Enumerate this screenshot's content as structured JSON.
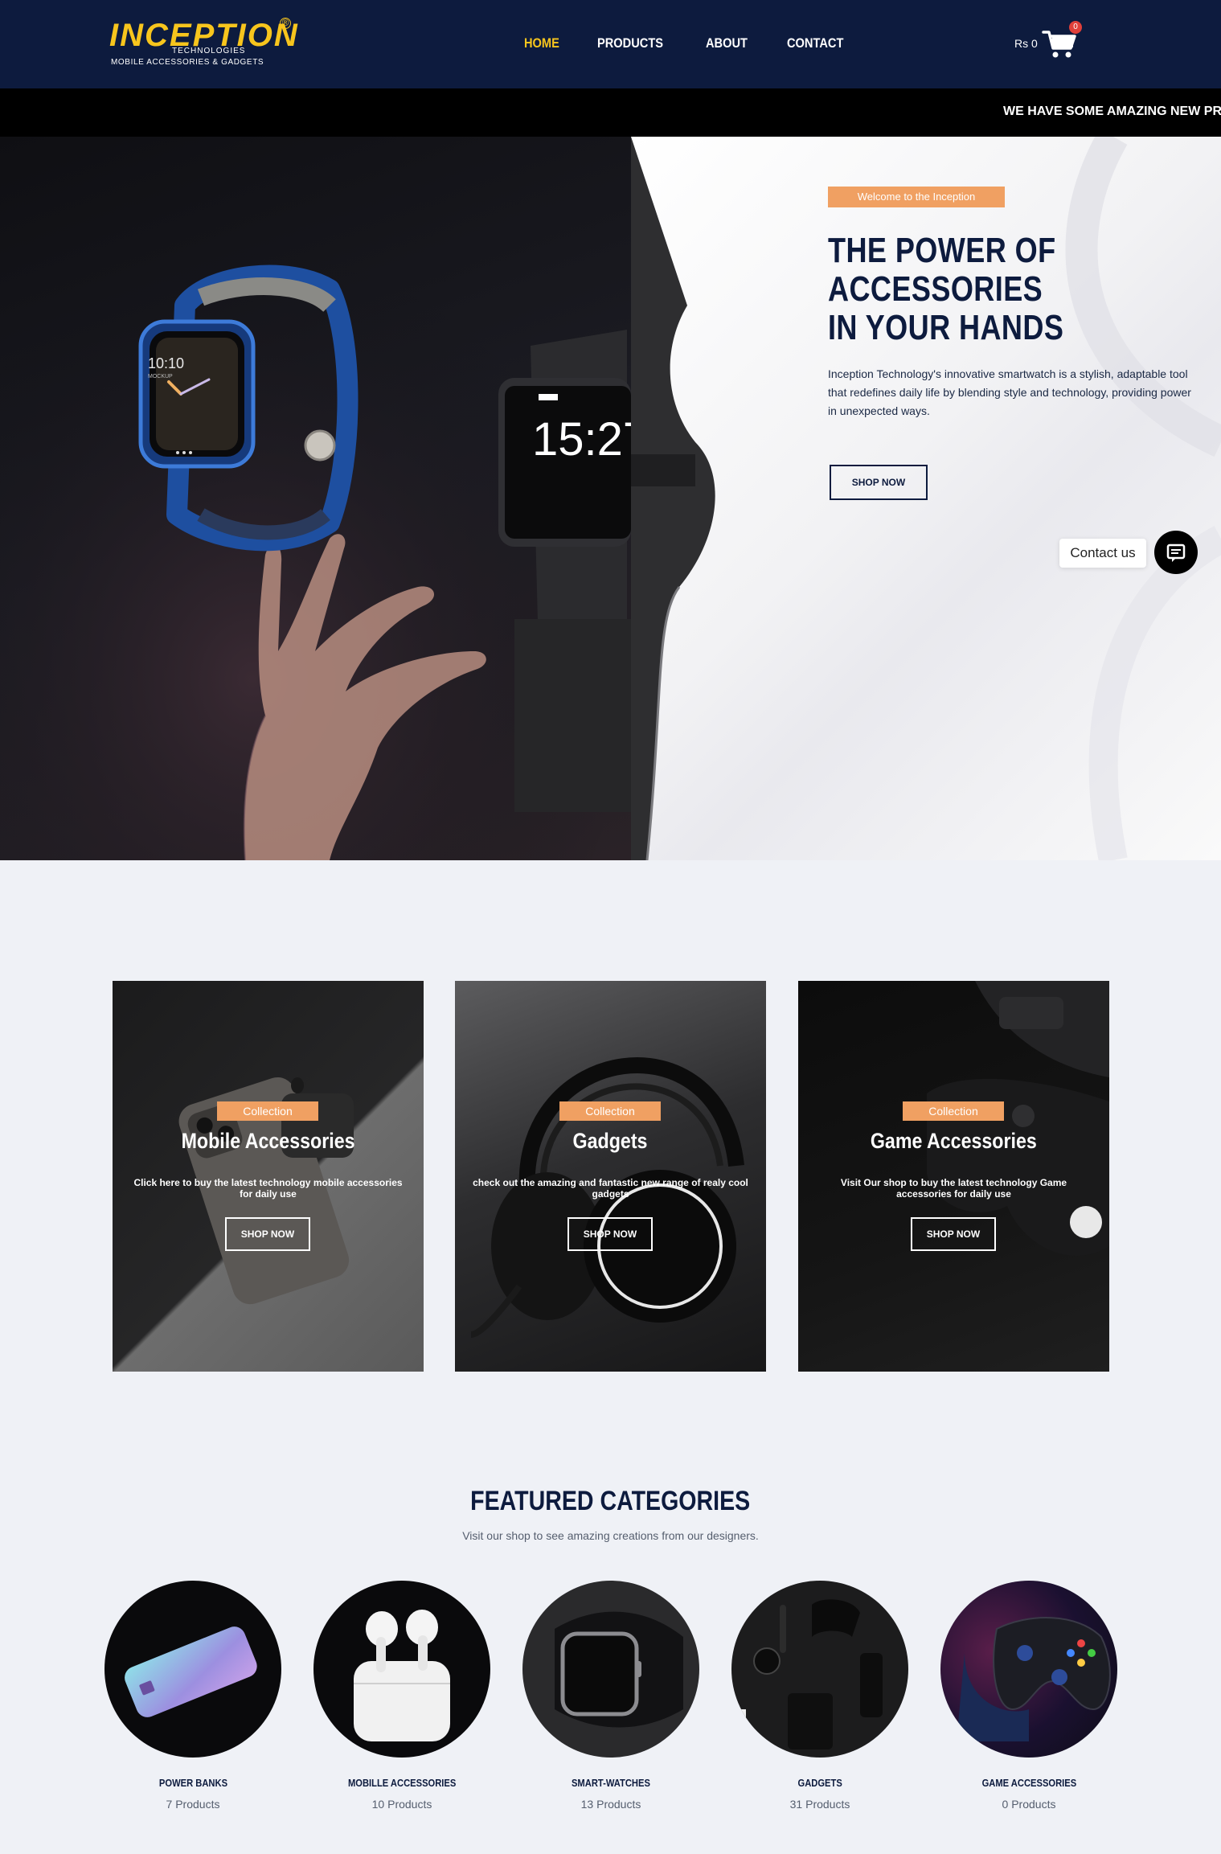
{
  "brand": {
    "name": "INCEPTION",
    "reg": "®",
    "line1": "TECHNOLOGIES",
    "line2": "MOBILE ACCESSORIES & GADGETS"
  },
  "nav": {
    "items": [
      {
        "label": "HOME",
        "active": true
      },
      {
        "label": "PRODUCTS",
        "active": false
      },
      {
        "label": "ABOUT",
        "active": false
      },
      {
        "label": "CONTACT",
        "active": false
      }
    ]
  },
  "cart": {
    "total": "Rs 0",
    "count": "0"
  },
  "ticker": {
    "text": "WE HAVE SOME AMAZING NEW PRO"
  },
  "hero": {
    "badge": "Welcome to the Inception",
    "title": "THE POWER OF ACCESSORIES IN YOUR HANDS",
    "description": "Inception Technology's innovative smartwatch is a stylish, adaptable tool that redefines daily life by blending style and technology, providing power in unexpected ways.",
    "button": "SHOP NOW",
    "watch1_time": "10:10",
    "watch1_label": "MOCKUP",
    "watch2_time": "15:27"
  },
  "contact_widget": {
    "label": "Contact us"
  },
  "collections": [
    {
      "badge": "Collection",
      "title": "Mobile Accessories",
      "description": "Click here to buy the latest technology mobile accessories for daily use",
      "button": "SHOP NOW"
    },
    {
      "badge": "Collection",
      "title": "Gadgets",
      "description": "check out the amazing and fantastic new range of realy cool gadgets",
      "button": "SHOP NOW"
    },
    {
      "badge": "Collection",
      "title": "Game Accessories",
      "description": "Visit Our shop to buy the latest technology Game accessories for daily use",
      "button": "SHOP NOW"
    }
  ],
  "featured": {
    "title": "FEATURED CATEGORIES",
    "subtitle": "Visit our shop to see amazing creations from our designers.",
    "categories": [
      {
        "name": "POWER BANKS",
        "count": "7 Products"
      },
      {
        "name": "MOBILLE ACCESSORIES",
        "count": "10 Products"
      },
      {
        "name": "SMART-WATCHES",
        "count": "13 Products"
      },
      {
        "name": "GADGETS",
        "count": "31 Products"
      },
      {
        "name": "GAME ACCESSORIES",
        "count": "0 Products"
      }
    ]
  },
  "colors": {
    "navy": "#0d1b3e",
    "yellow": "#f7c51d",
    "orange": "#f0a062",
    "page_bg": "#eff1f6"
  }
}
